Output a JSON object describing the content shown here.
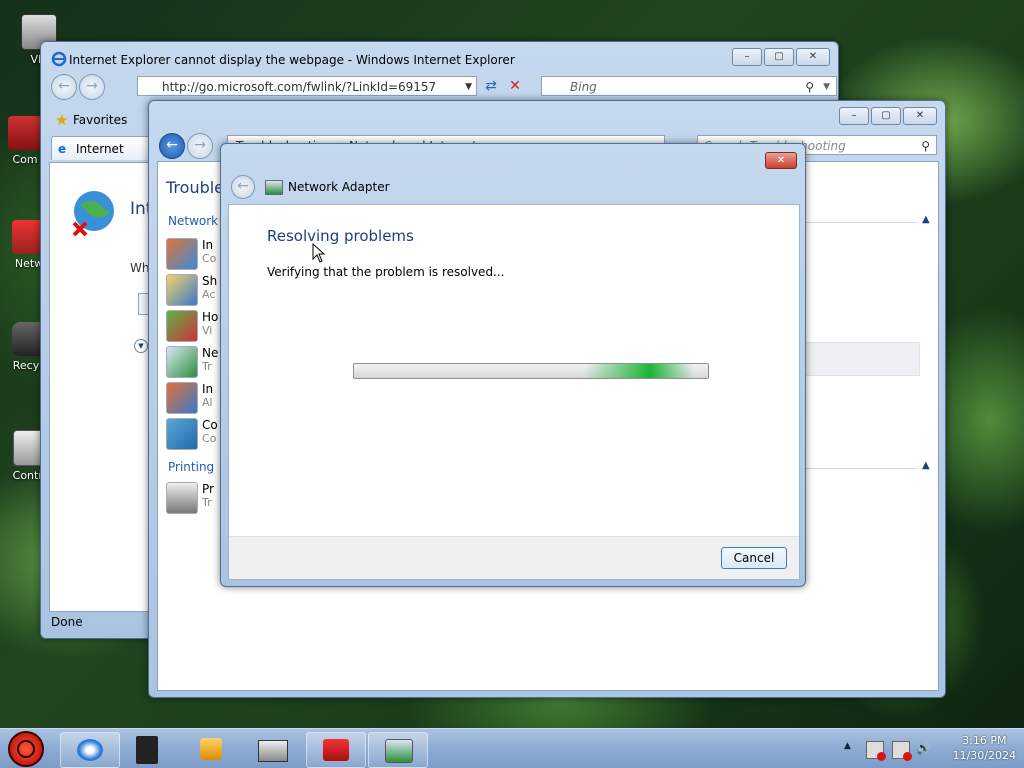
{
  "desktop": {
    "icons": [
      {
        "label": "VM"
      },
      {
        "label": "Com"
      },
      {
        "label": "Netw"
      },
      {
        "label": "Recyc"
      },
      {
        "label": "Contro"
      }
    ]
  },
  "ie_window": {
    "title": "Internet Explorer cannot display the webpage - Windows Internet Explorer",
    "address": "http://go.microsoft.com/fwlink/?LinkId=69157",
    "search_placeholder": "Bing",
    "favorites_label": "Favorites",
    "tab_label": "Internet Explor",
    "page_heading": "Int",
    "page_text": "Wh",
    "status": "Done"
  },
  "cp_window": {
    "breadcrumb": "Troubleshooting > Network and Internet",
    "search_placeholder": "Search Troubleshooting",
    "heading": "Troubles",
    "section_network": "Network",
    "section_printing": "Printing",
    "items": [
      {
        "name": "In",
        "sub": "Co"
      },
      {
        "name": "Sh",
        "sub": "Ac"
      },
      {
        "name": "Ho",
        "sub": "Vi"
      },
      {
        "name": "Ne",
        "sub": "Tr"
      },
      {
        "name": "In",
        "sub": "Al"
      },
      {
        "name": "Co",
        "sub": "Co"
      },
      {
        "name": "Pr",
        "sub": "Tr"
      }
    ]
  },
  "dialog": {
    "title": "Network Adapter",
    "heading": "Resolving problems",
    "message": "Verifying that the problem is resolved...",
    "cancel_label": "Cancel",
    "progress_indeterminate": true
  },
  "taskbar": {
    "time": "3:16 PM",
    "date": "11/30/2024"
  },
  "colors": {
    "heading_blue": "#1e3f82",
    "link_blue": "#1f5fa8",
    "progress_green": "#06b025"
  }
}
